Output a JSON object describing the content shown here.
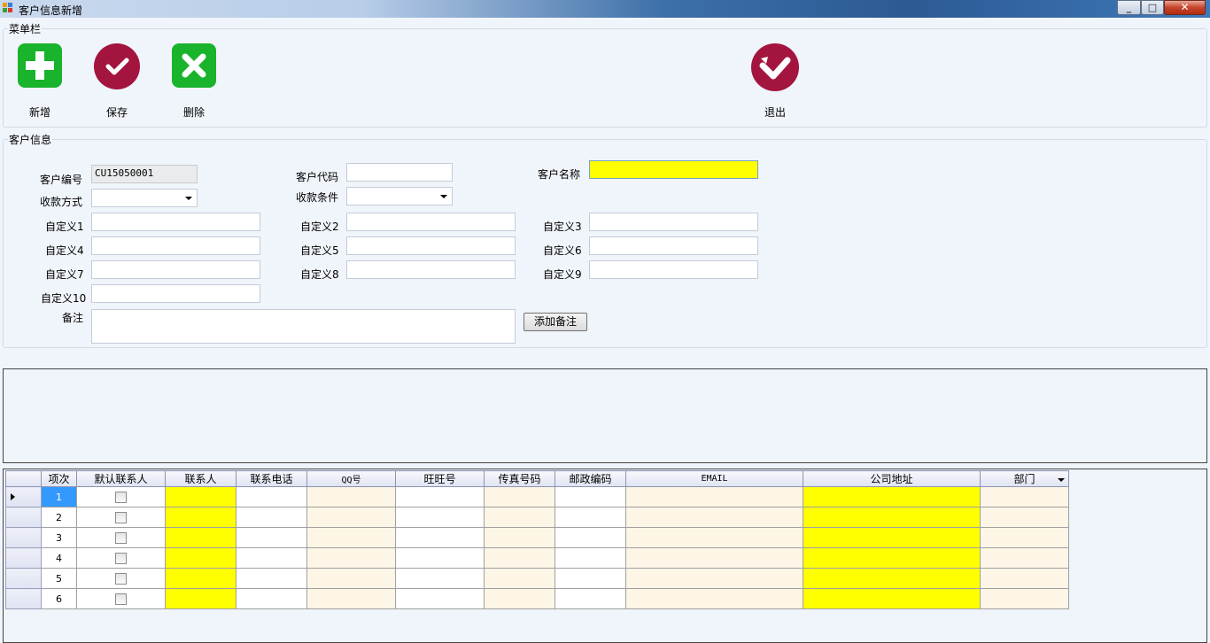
{
  "window": {
    "title": "客户信息新增",
    "min": "_",
    "max": "□",
    "close": "✕"
  },
  "menu": {
    "group_label": "菜单栏",
    "buttons": [
      {
        "label": "新增",
        "icon": "plus-icon",
        "color": "#19b32c"
      },
      {
        "label": "保存",
        "icon": "check-icon",
        "color": "#a3153f"
      },
      {
        "label": "删除",
        "icon": "x-icon",
        "color": "#19b32c"
      },
      {
        "label": "退出",
        "icon": "exit-icon",
        "color": "#a3153f"
      }
    ]
  },
  "customer": {
    "group_label": "客户信息",
    "customer_no_label": "客户编号",
    "customer_no_value": "CU15050001",
    "customer_code_label": "客户代码",
    "customer_code_value": "",
    "customer_name_label": "客户名称",
    "customer_name_value": "",
    "payment_method_label": "收款方式",
    "payment_method_value": "",
    "payment_terms_label": "收款条件",
    "payment_terms_value": "",
    "custom_labels": [
      "自定义1",
      "自定义2",
      "自定义3",
      "自定义4",
      "自定义5",
      "自定义6",
      "自定义7",
      "自定义8",
      "自定义9",
      "自定义10"
    ],
    "remark_label": "备注",
    "remark_value": "",
    "add_remark_button": "添加备注",
    "highlight_color": "#ffff00"
  },
  "contacts_grid": {
    "columns": [
      "项次",
      "默认联系人",
      "联系人",
      "联系电话",
      "QQ号",
      "旺旺号",
      "传真号码",
      "邮政编码",
      "EMAIL",
      "公司地址",
      "部门"
    ],
    "rows": [
      {
        "idx": "1",
        "default": false
      },
      {
        "idx": "2",
        "default": false
      },
      {
        "idx": "3",
        "default": false
      },
      {
        "idx": "4",
        "default": false
      },
      {
        "idx": "5",
        "default": false
      },
      {
        "idx": "6",
        "default": false
      }
    ],
    "selected_row": 0
  }
}
